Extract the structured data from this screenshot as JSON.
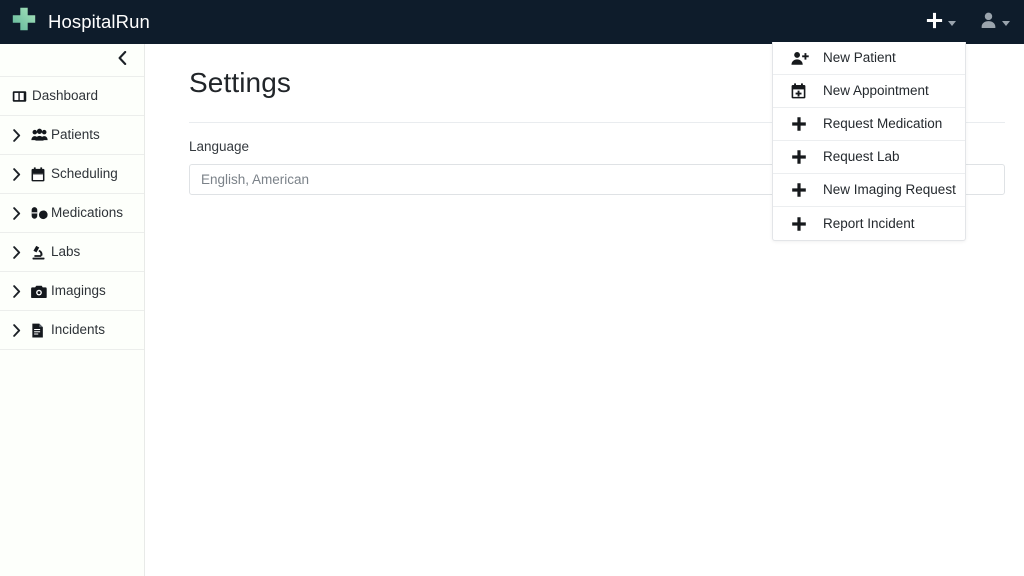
{
  "navbar": {
    "brand": "HospitalRun",
    "logo_icon": "medical-cross-icon",
    "new_button_icon": "plus-icon",
    "new_button_caret_icon": "caret-down-icon",
    "user_button_icon": "user-icon",
    "user_button_caret_icon": "caret-down-icon",
    "background_color": "#0e1c2b",
    "logo_color": "#7fd2ae"
  },
  "sidebar": {
    "collapse_icon": "chevron-left-icon",
    "items": [
      {
        "label": "Dashboard",
        "icon": "dashboard-columns-icon",
        "expandable": false,
        "chevron": ""
      },
      {
        "label": "Patients",
        "icon": "users-group-icon",
        "expandable": true,
        "chevron": "chevron-right-icon"
      },
      {
        "label": "Scheduling",
        "icon": "calendar-icon",
        "expandable": true,
        "chevron": "chevron-right-icon"
      },
      {
        "label": "Medications",
        "icon": "pills-icon",
        "expandable": true,
        "chevron": "chevron-right-icon"
      },
      {
        "label": "Labs",
        "icon": "microscope-icon",
        "expandable": true,
        "chevron": "chevron-right-icon"
      },
      {
        "label": "Imagings",
        "icon": "camera-icon",
        "expandable": true,
        "chevron": "chevron-right-icon"
      },
      {
        "label": "Incidents",
        "icon": "file-document-icon",
        "expandable": true,
        "chevron": "chevron-right-icon"
      }
    ]
  },
  "main": {
    "title": "Settings",
    "language_label": "Language",
    "language_value": "English, American"
  },
  "new_dropdown": {
    "items": [
      {
        "label": "New Patient",
        "icon": "user-plus-icon"
      },
      {
        "label": "New Appointment",
        "icon": "calendar-plus-icon"
      },
      {
        "label": "Request Medication",
        "icon": "plus-icon"
      },
      {
        "label": "Request Lab",
        "icon": "plus-icon"
      },
      {
        "label": "New Imaging Request",
        "icon": "plus-icon"
      },
      {
        "label": "Report Incident",
        "icon": "plus-icon"
      }
    ]
  }
}
